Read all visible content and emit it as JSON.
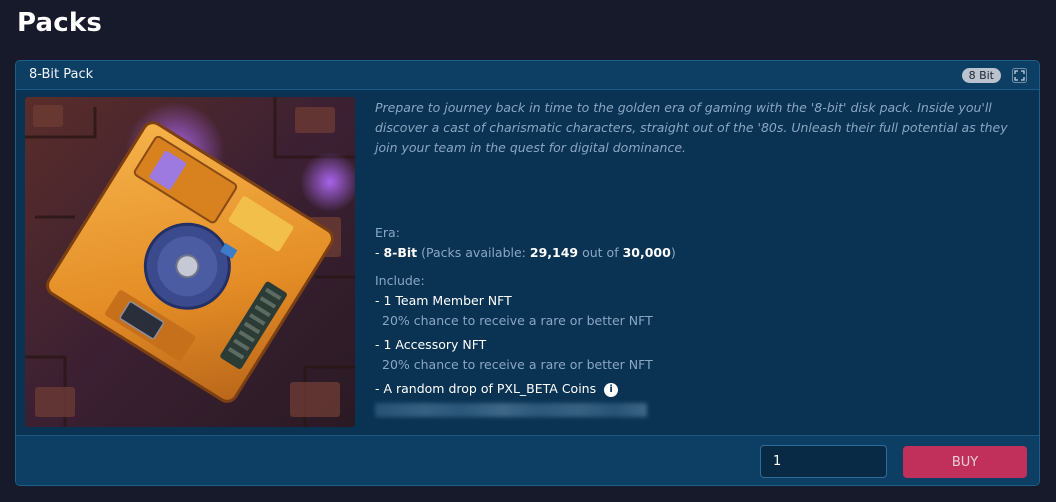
{
  "page": {
    "title": "Packs"
  },
  "pack": {
    "title": "8-Bit Pack",
    "badge": "8 Bit",
    "description": "Prepare to journey back in time to the golden era of gaming with the '8-bit' disk pack. Inside you'll discover a cast of charismatic characters, straight out of the '80s. Unleash their full potential as they join your team in the quest for digital dominance.",
    "era_label": "Era:",
    "era": {
      "prefix": "- ",
      "name": "8-Bit",
      "avail_open": " (Packs available: ",
      "available": "29,149",
      "out_of": " out of ",
      "total": "30,000",
      "avail_close": ")"
    },
    "include_label": "Include:",
    "includes": [
      {
        "text": "- 1 Team Member NFT",
        "sub": "20% chance to receive a rare or better NFT"
      },
      {
        "text": "- 1 Accessory NFT",
        "sub": "20% chance to receive a rare or better NFT"
      },
      {
        "text": "- A random drop of PXL_BETA Coins"
      }
    ],
    "info_icon": "i"
  },
  "footer": {
    "quantity_value": "1",
    "buy_label": "BUY"
  },
  "colors": {
    "background": "#161a2b",
    "card": "#0a3252",
    "buy_button": "#c0305a"
  }
}
